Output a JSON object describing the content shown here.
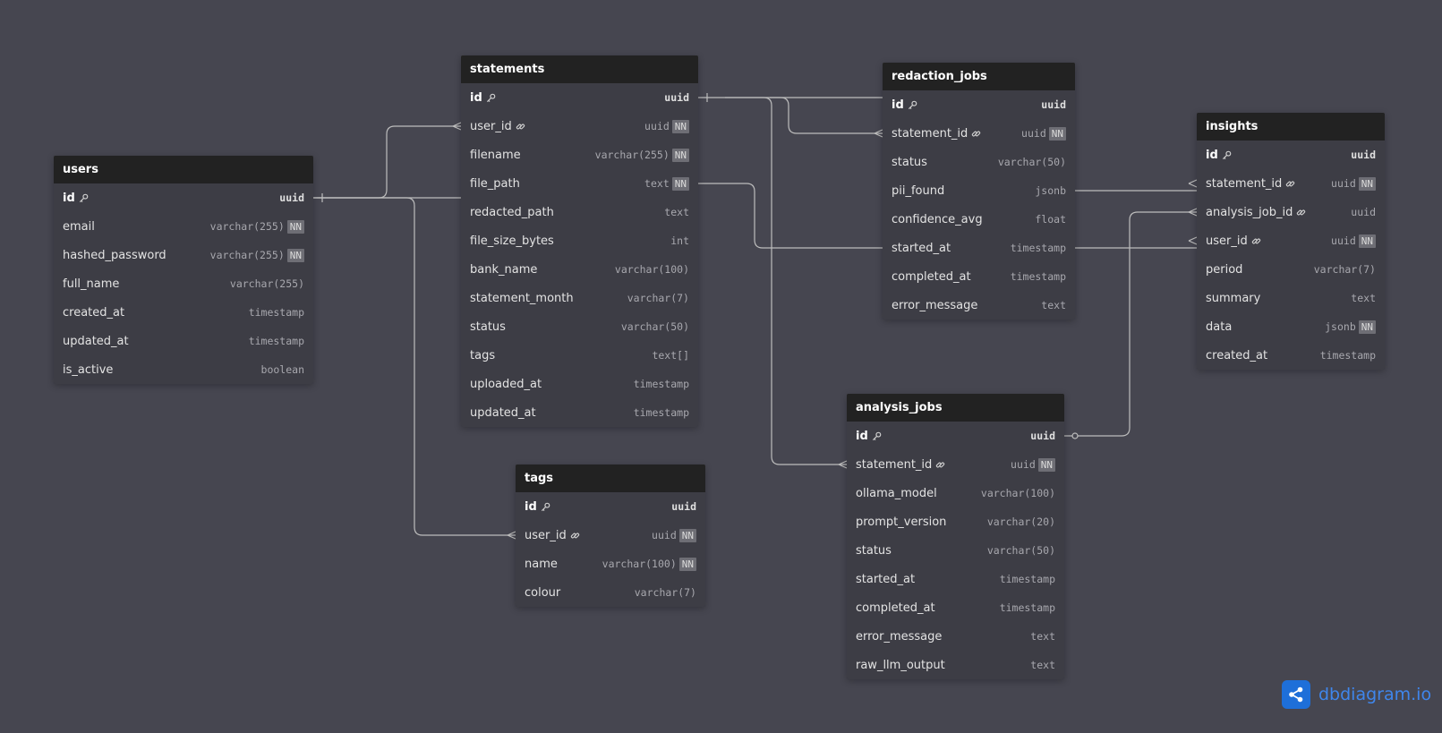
{
  "brand": {
    "name": "dbdiagram.io",
    "icon": "share-icon",
    "color": "#1e6fd9"
  },
  "colors": {
    "canvas": "#464650",
    "table_header": "#222222",
    "table_body": "#3d3d45",
    "relation_line": "#bdbdbd"
  },
  "tables": [
    {
      "id": "users",
      "name": "users",
      "fields": [
        {
          "name": "id",
          "type": "uuid",
          "pk": true
        },
        {
          "name": "email",
          "type": "varchar(255)",
          "nn": true
        },
        {
          "name": "hashed_password",
          "type": "varchar(255)",
          "nn": true
        },
        {
          "name": "full_name",
          "type": "varchar(255)"
        },
        {
          "name": "created_at",
          "type": "timestamp"
        },
        {
          "name": "updated_at",
          "type": "timestamp"
        },
        {
          "name": "is_active",
          "type": "boolean"
        }
      ]
    },
    {
      "id": "statements",
      "name": "statements",
      "fields": [
        {
          "name": "id",
          "type": "uuid",
          "pk": true
        },
        {
          "name": "user_id",
          "type": "uuid",
          "fk": true,
          "nn": true
        },
        {
          "name": "filename",
          "type": "varchar(255)",
          "nn": true
        },
        {
          "name": "file_path",
          "type": "text",
          "nn": true
        },
        {
          "name": "redacted_path",
          "type": "text"
        },
        {
          "name": "file_size_bytes",
          "type": "int"
        },
        {
          "name": "bank_name",
          "type": "varchar(100)"
        },
        {
          "name": "statement_month",
          "type": "varchar(7)"
        },
        {
          "name": "status",
          "type": "varchar(50)"
        },
        {
          "name": "tags",
          "type": "text[]"
        },
        {
          "name": "uploaded_at",
          "type": "timestamp"
        },
        {
          "name": "updated_at",
          "type": "timestamp"
        }
      ]
    },
    {
      "id": "tags",
      "name": "tags",
      "fields": [
        {
          "name": "id",
          "type": "uuid",
          "pk": true
        },
        {
          "name": "user_id",
          "type": "uuid",
          "fk": true,
          "nn": true
        },
        {
          "name": "name",
          "type": "varchar(100)",
          "nn": true
        },
        {
          "name": "colour",
          "type": "varchar(7)"
        }
      ]
    },
    {
      "id": "redaction_jobs",
      "name": "redaction_jobs",
      "fields": [
        {
          "name": "id",
          "type": "uuid",
          "pk": true
        },
        {
          "name": "statement_id",
          "type": "uuid",
          "fk": true,
          "nn": true
        },
        {
          "name": "status",
          "type": "varchar(50)"
        },
        {
          "name": "pii_found",
          "type": "jsonb"
        },
        {
          "name": "confidence_avg",
          "type": "float"
        },
        {
          "name": "started_at",
          "type": "timestamp"
        },
        {
          "name": "completed_at",
          "type": "timestamp"
        },
        {
          "name": "error_message",
          "type": "text"
        }
      ]
    },
    {
      "id": "analysis_jobs",
      "name": "analysis_jobs",
      "fields": [
        {
          "name": "id",
          "type": "uuid",
          "pk": true
        },
        {
          "name": "statement_id",
          "type": "uuid",
          "fk": true,
          "nn": true
        },
        {
          "name": "ollama_model",
          "type": "varchar(100)"
        },
        {
          "name": "prompt_version",
          "type": "varchar(20)"
        },
        {
          "name": "status",
          "type": "varchar(50)"
        },
        {
          "name": "started_at",
          "type": "timestamp"
        },
        {
          "name": "completed_at",
          "type": "timestamp"
        },
        {
          "name": "error_message",
          "type": "text"
        },
        {
          "name": "raw_llm_output",
          "type": "text"
        }
      ]
    },
    {
      "id": "insights",
      "name": "insights",
      "fields": [
        {
          "name": "id",
          "type": "uuid",
          "pk": true
        },
        {
          "name": "statement_id",
          "type": "uuid",
          "fk": true,
          "nn": true
        },
        {
          "name": "analysis_job_id",
          "type": "uuid",
          "fk": true
        },
        {
          "name": "user_id",
          "type": "uuid",
          "fk": true,
          "nn": true
        },
        {
          "name": "period",
          "type": "varchar(7)"
        },
        {
          "name": "summary",
          "type": "text"
        },
        {
          "name": "data",
          "type": "jsonb",
          "nn": true
        },
        {
          "name": "created_at",
          "type": "timestamp"
        }
      ]
    }
  ],
  "relationships": [
    {
      "from": "users.id",
      "to": "statements.user_id",
      "type": "one-to-many"
    },
    {
      "from": "users.id",
      "to": "tags.user_id",
      "type": "one-to-many"
    },
    {
      "from": "statements.id",
      "to": "redaction_jobs.statement_id",
      "type": "one-to-many"
    },
    {
      "from": "statements.id",
      "to": "analysis_jobs.statement_id",
      "type": "one-to-many"
    },
    {
      "from": "statements.id",
      "to": "insights.statement_id",
      "type": "one-to-many"
    },
    {
      "from": "users.id",
      "to": "insights.user_id",
      "type": "one-to-many"
    },
    {
      "from": "analysis_jobs.id",
      "to": "insights.analysis_job_id",
      "type": "zero-or-one-to-many"
    }
  ]
}
